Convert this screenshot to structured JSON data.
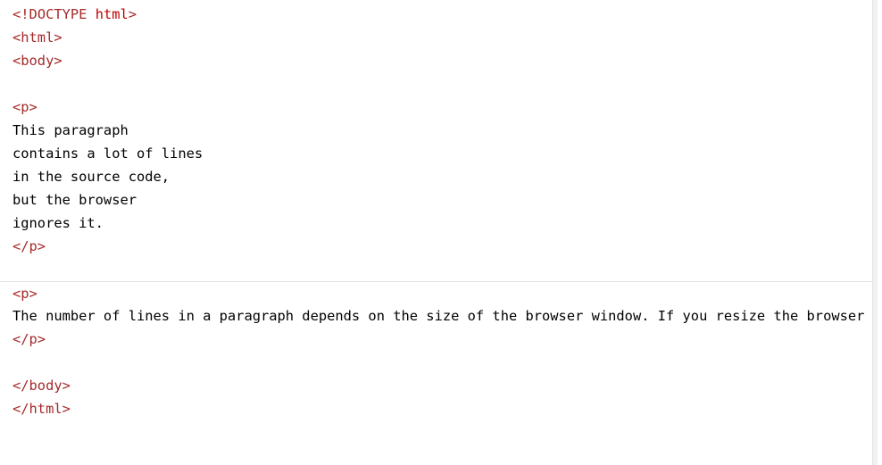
{
  "editor": {
    "lines": [
      {
        "kind": "doctype",
        "open": "<!",
        "keyword": "DOCTYPE",
        "value": " html",
        "close": ">"
      },
      {
        "kind": "tag",
        "text": "<html>"
      },
      {
        "kind": "tag",
        "text": "<body>"
      },
      {
        "kind": "blank",
        "text": ""
      },
      {
        "kind": "tag",
        "text": "<p>"
      },
      {
        "kind": "text",
        "text": "This paragraph"
      },
      {
        "kind": "text",
        "text": "contains a lot of lines"
      },
      {
        "kind": "text",
        "text": "in the source code,"
      },
      {
        "kind": "text",
        "text": "but the browser"
      },
      {
        "kind": "text",
        "text": "ignores it."
      },
      {
        "kind": "tag",
        "text": "</p>"
      },
      {
        "kind": "blank",
        "text": ""
      },
      {
        "kind": "tag",
        "text": "<p>",
        "active": true
      },
      {
        "kind": "text",
        "text": "The number of lines in a paragraph depends on the size of the browser window. If you resize the browser window, the number of lines in this paragraph will change."
      },
      {
        "kind": "tag",
        "text": "</p>"
      },
      {
        "kind": "blank",
        "text": ""
      },
      {
        "kind": "tag",
        "text": "</body>"
      },
      {
        "kind": "tag",
        "text": "</html>"
      }
    ]
  },
  "colors": {
    "tag": "#a52a2a",
    "doctype_value": "#c00000",
    "text": "#000000",
    "background": "#ffffff"
  }
}
